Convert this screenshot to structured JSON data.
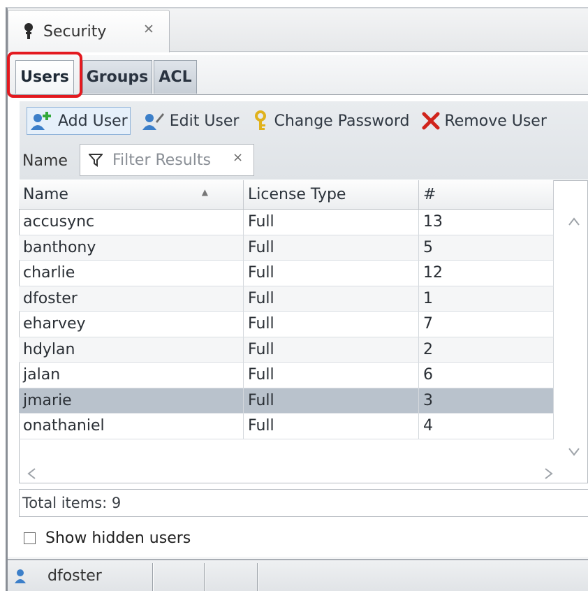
{
  "editor_tab": {
    "title": "Security",
    "close_glyph": "✕"
  },
  "inner_tabs": [
    {
      "label": "Users",
      "selected": true
    },
    {
      "label": "Groups",
      "selected": false
    },
    {
      "label": "ACL",
      "selected": false
    }
  ],
  "toolbar": {
    "add_user": "Add User",
    "edit_user": "Edit User",
    "change_password": "Change Password",
    "remove_user": "Remove User"
  },
  "filter": {
    "label": "Name",
    "placeholder": "Filter Results",
    "clear_glyph": "×"
  },
  "table": {
    "columns": [
      "Name",
      "License Type",
      "#"
    ],
    "sort_indicator": "▲",
    "rows": [
      {
        "name": "accusync",
        "license": "Full",
        "count": "13"
      },
      {
        "name": "banthony",
        "license": "Full",
        "count": "5"
      },
      {
        "name": "charlie",
        "license": "Full",
        "count": "12"
      },
      {
        "name": "dfoster",
        "license": "Full",
        "count": "1"
      },
      {
        "name": "eharvey",
        "license": "Full",
        "count": "7"
      },
      {
        "name": "hdylan",
        "license": "Full",
        "count": "2"
      },
      {
        "name": "jalan",
        "license": "Full",
        "count": "6"
      },
      {
        "name": "jmarie",
        "license": "Full",
        "count": "3"
      },
      {
        "name": "onathaniel",
        "license": "Full",
        "count": "4"
      }
    ],
    "selected_row": "jmarie"
  },
  "footer": {
    "total_items": "Total items: 9",
    "show_hidden_users": "Show hidden users",
    "show_hidden_checked": false
  },
  "status_bar": {
    "current_user": "dfoster"
  },
  "colors": {
    "highlight_border": "#e3191f",
    "selected_row": "#b9c2cc",
    "remove_icon": "#d0231b",
    "key_icon": "#e0b21d",
    "add_icon": "#33a93a"
  }
}
